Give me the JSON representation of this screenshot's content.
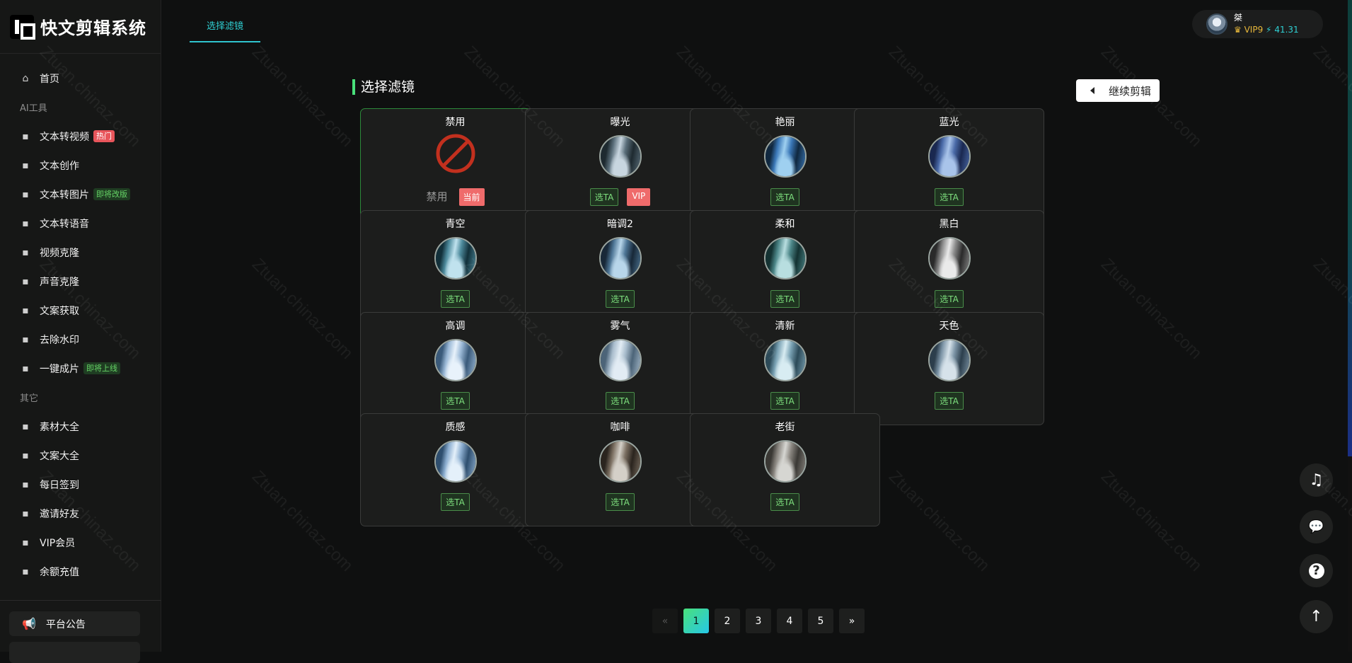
{
  "app": {
    "title": "快文剪辑系统"
  },
  "sidebar": {
    "home": "首页",
    "section_ai": "AI工具",
    "items_ai": [
      {
        "label": "文本转视频",
        "tag": "热门",
        "icon": "magic-wand-icon"
      },
      {
        "label": "文本创作",
        "tag": "",
        "icon": "keyboard-icon"
      },
      {
        "label": "文本转图片",
        "tag": "即将改版",
        "icon": "image-icon"
      },
      {
        "label": "文本转语音",
        "tag": "",
        "icon": "speaker-icon"
      },
      {
        "label": "视频克隆",
        "tag": "",
        "icon": "copy-icon"
      },
      {
        "label": "声音克隆",
        "tag": "",
        "icon": "users-icon"
      },
      {
        "label": "文案获取",
        "tag": "",
        "icon": "text-size-icon"
      },
      {
        "label": "去除水印",
        "tag": "",
        "icon": "no-watermark-icon"
      },
      {
        "label": "一键成片",
        "tag": "即将上线",
        "icon": "scissors-icon"
      }
    ],
    "section_other": "其它",
    "items_other": [
      {
        "label": "素材大全",
        "icon": "list-icon"
      },
      {
        "label": "文案大全",
        "icon": "book-icon"
      },
      {
        "label": "每日签到",
        "icon": "flag-icon"
      },
      {
        "label": "邀请好友",
        "icon": "invite-icon"
      },
      {
        "label": "VIP会员",
        "icon": "id-card-icon"
      },
      {
        "label": "余额充值",
        "icon": "wallet-icon"
      }
    ],
    "notice": "平台公告"
  },
  "tabs": [
    {
      "label": "选择滤镜",
      "active": true
    }
  ],
  "user": {
    "name": "桀",
    "vip": "VIP9",
    "balance": "41.31"
  },
  "main": {
    "title": "选择滤镜",
    "continue_label": "继续剪辑",
    "pick_label": "选TA",
    "vip_label": "VIP",
    "disabled_text": "禁用",
    "current_label": "当前",
    "filters": [
      {
        "name": "禁用",
        "type": "disabled"
      },
      {
        "name": "曝光",
        "vip": true
      },
      {
        "name": "艳丽"
      },
      {
        "name": "蓝光"
      },
      {
        "name": "青空"
      },
      {
        "name": "暗调2"
      },
      {
        "name": "柔和"
      },
      {
        "name": "黑白"
      },
      {
        "name": "高调"
      },
      {
        "name": "雾气"
      },
      {
        "name": "清新"
      },
      {
        "name": "天色"
      },
      {
        "name": "质感"
      },
      {
        "name": "咖啡"
      },
      {
        "name": "老街"
      }
    ]
  },
  "pagination": {
    "prev": "«",
    "pages": [
      "1",
      "2",
      "3",
      "4",
      "5"
    ],
    "current": "1",
    "next": "»"
  },
  "watermark": "Ztuan.chinaz.com"
}
